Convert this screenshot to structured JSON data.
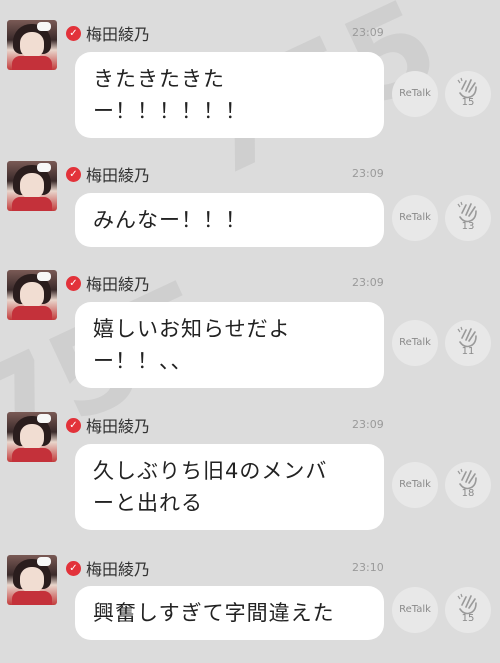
{
  "messages": [
    {
      "name": "梅田綾乃",
      "time": "23:09",
      "text": "きたきたきた\nー！！！！！！",
      "retalk_label": "ReTalk",
      "like_count": "15"
    },
    {
      "name": "梅田綾乃",
      "time": "23:09",
      "text": "みんなー！！！",
      "retalk_label": "ReTalk",
      "like_count": "13"
    },
    {
      "name": "梅田綾乃",
      "time": "23:09",
      "text": "嬉しいお知らせだよ\nー！！、、",
      "retalk_label": "ReTalk",
      "like_count": "11"
    },
    {
      "name": "梅田綾乃",
      "time": "23:09",
      "text": "久しぶりち旧4のメンバ\nーと出れる",
      "retalk_label": "ReTalk",
      "like_count": "18"
    },
    {
      "name": "梅田綾乃",
      "time": "23:10",
      "text": "興奮しすぎて字間違えた",
      "retalk_label": "ReTalk",
      "like_count": "15"
    }
  ],
  "colors": {
    "background": "#dcdcdc",
    "verified": "#e2323a",
    "bubble": "#ffffff"
  },
  "icons": {
    "verified": "check-badge-icon",
    "like": "clap-hand-icon"
  }
}
